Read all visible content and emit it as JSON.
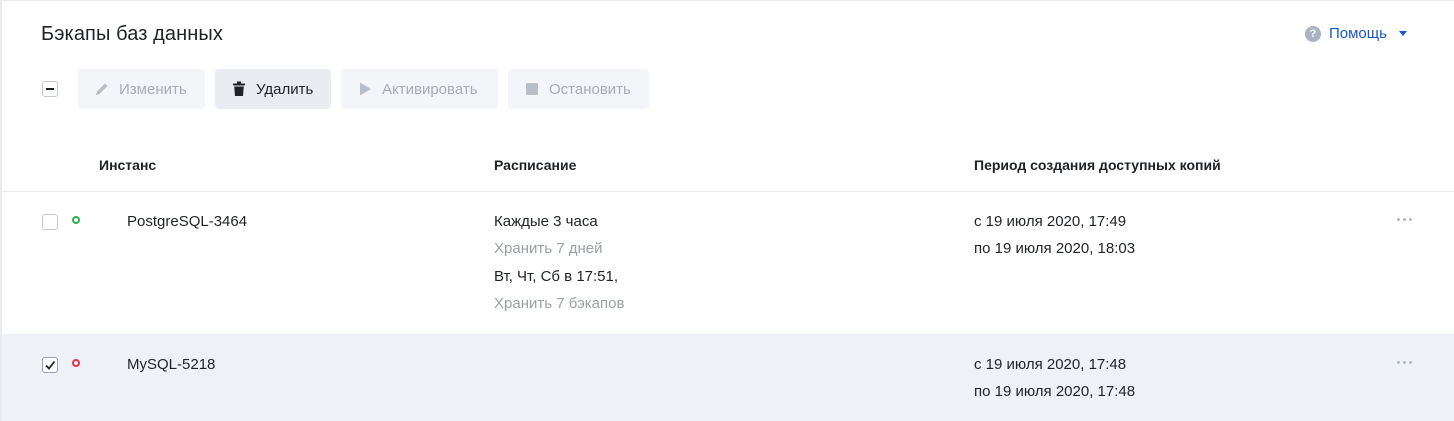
{
  "page": {
    "title": "Бэкапы баз данных",
    "help_label": "Помощь"
  },
  "toolbar": {
    "edit": "Изменить",
    "delete": "Удалить",
    "activate": "Активировать",
    "stop": "Остановить"
  },
  "table": {
    "headers": [
      "Инстанс",
      "Расписание",
      "Период создания доступных копий"
    ],
    "rows": [
      {
        "instance": "PostgreSQL-3464",
        "status": "active",
        "status_color": "#2db34a",
        "selected": false,
        "schedule": [
          "Каждые 3 часа",
          "Хранить 7 дней",
          "Вт, Чт, Сб в 17:51,",
          "Хранить 7 бэкапов"
        ],
        "period_from": "с 19 июля 2020, 17:49",
        "period_to": "по 19 июля 2020, 18:03"
      },
      {
        "instance": "MySQL-5218",
        "status": "inactive",
        "status_color": "#e5334b",
        "selected": true,
        "schedule": [],
        "period_from": "с 19 июля 2020, 17:48",
        "period_to": "по 19 июля 2020, 17:48"
      }
    ]
  },
  "colors": {
    "accent": "#1658c8",
    "row_selected_bg": "#eef1f5",
    "button_bg": "#f3f5f8"
  }
}
